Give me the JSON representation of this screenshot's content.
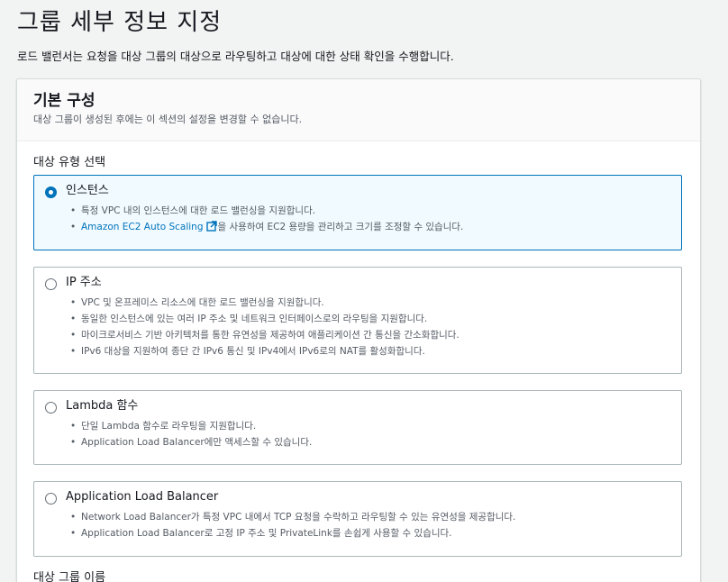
{
  "page": {
    "title": "그룹 세부 정보 지정",
    "description": "로드 밸런서는 요청을 대상 그룹의 대상으로 라우팅하고 대상에 대한 상태 확인을 수행합니다."
  },
  "section": {
    "title": "기본 구성",
    "description": "대상 그룹이 생성된 후에는 이 섹션의 설정을 변경할 수 없습니다."
  },
  "target_type": {
    "label": "대상 유형 선택",
    "options": [
      {
        "title": "인스턴스",
        "selected": true,
        "bullets": [
          "특정 VPC 내의 인스턴스에 대한 로드 밸런싱을 지원합니다.",
          "을 사용하여 EC2 용량을 관리하고 크기를 조정할 수 있습니다."
        ],
        "link_text": "Amazon EC2 Auto Scaling"
      },
      {
        "title": "IP 주소",
        "selected": false,
        "bullets": [
          "VPC 및 온프레미스 리소스에 대한 로드 밸런싱을 지원합니다.",
          "동일한 인스턴스에 있는 여러 IP 주소 및 네트워크 인터페이스로의 라우팅을 지원합니다.",
          "마이크로서비스 기반 아키텍처를 통한 유연성을 제공하여 애플리케이션 간 통신을 간소화합니다.",
          "IPv6 대상을 지원하여 종단 간 IPv6 통신 및 IPv4에서 IPv6로의 NAT를 활성화합니다."
        ]
      },
      {
        "title": "Lambda 함수",
        "selected": false,
        "bullets": [
          "단일 Lambda 함수로 라우팅을 지원합니다.",
          "Application Load Balancer에만 액세스할 수 있습니다."
        ]
      },
      {
        "title": "Application Load Balancer",
        "selected": false,
        "bullets": [
          "Network Load Balancer가 특정 VPC 내에서 TCP 요청을 수락하고 라우팅할 수 있는 유연성을 제공합니다.",
          "Application Load Balancer로 고정 IP 주소 및 PrivateLink를 손쉽게 사용할 수 있습니다."
        ]
      }
    ]
  },
  "target_group_name": {
    "label": "대상 그룹 이름"
  },
  "colors": {
    "accent": "#0073bb",
    "selected_bg": "#f1faff",
    "border": "#aab7b8",
    "secondary_text": "#545b64"
  },
  "icons": {
    "external_link": "external-link-icon",
    "bullet": "•"
  }
}
